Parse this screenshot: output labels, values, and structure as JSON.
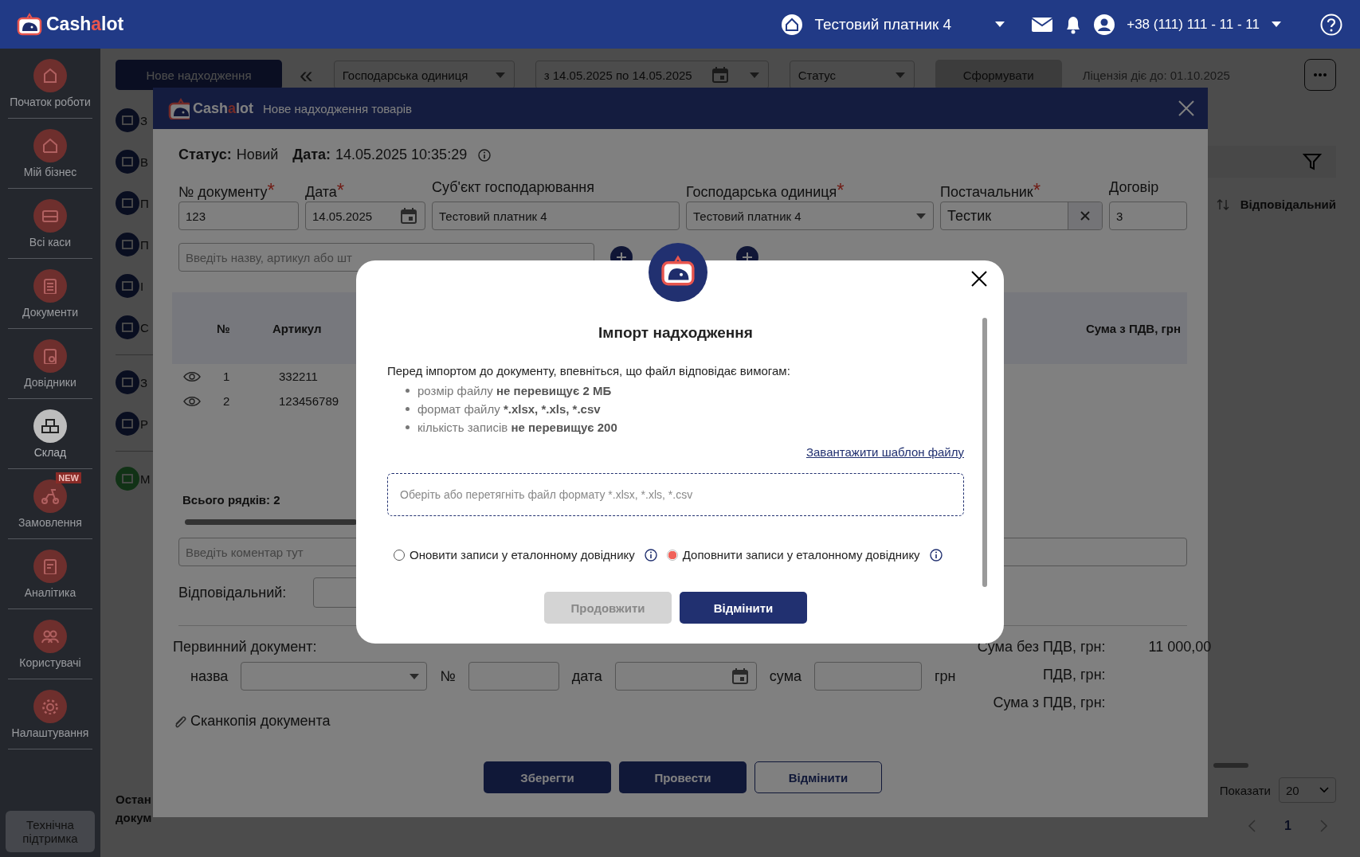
{
  "topbar": {
    "logo": [
      {
        "text": "Cash",
        "accent": false
      },
      {
        "text": "a",
        "accent": true
      },
      {
        "text": "lot",
        "accent": false
      }
    ],
    "company": "Тестовий платник 4",
    "phone": "+38 (111) 111 - 11 - 11"
  },
  "sidebar": {
    "items": [
      {
        "label": "Початок роботи",
        "selected": false
      },
      {
        "label": "Мій бізнес",
        "selected": false
      },
      {
        "label": "Всі каси",
        "selected": false
      },
      {
        "label": "Документи",
        "selected": false
      },
      {
        "label": "Довідники",
        "selected": false
      },
      {
        "label": "Склад",
        "selected": true
      },
      {
        "label": "Замовлення",
        "selected": false,
        "badge": "NEW"
      },
      {
        "label": "Аналітика",
        "selected": false
      },
      {
        "label": "Користувачі",
        "selected": false
      },
      {
        "label": "Налаштування",
        "selected": false
      }
    ],
    "support": "Технічна підтримка"
  },
  "toolbar": {
    "new_button": "Нове надходження",
    "collapse": "«",
    "filters": [
      "Господарська одиниця",
      "з 14.05.2025 по 14.05.2025",
      "Статус"
    ],
    "generate_button": "Сформувати",
    "license": "Ліцензія діє до: 01.10.2025"
  },
  "submenu": {
    "items": [
      "З",
      "В",
      "П",
      "П",
      "І",
      "С",
      "З",
      "Р",
      "М"
    ]
  },
  "list": {
    "column": "Відповідальний",
    "footer": [
      "Остан",
      "докум"
    ],
    "show_label": "Показати",
    "page_size": "20",
    "page": "1"
  },
  "document": {
    "logo": [
      {
        "text": "Cash",
        "accent": false
      },
      {
        "text": "a",
        "accent": true
      },
      {
        "text": "lot",
        "accent": false
      }
    ],
    "title": "Нове надходження товарів",
    "status_label": "Статус:",
    "status": "Новий",
    "date_label": "Дата:",
    "date": "14.05.2025 10:35:29",
    "fields": [
      {
        "label": "№ документу",
        "required_mark": "*",
        "value": "123",
        "kind": "text"
      },
      {
        "label": "Дата",
        "required_mark": "*",
        "value": "14.05.2025",
        "kind": "date"
      },
      {
        "label": "Суб'єкт господарювання",
        "value": "Тестовий платник 4",
        "kind": "text"
      },
      {
        "label": "Господарська одиниця",
        "required_mark": "*",
        "value": "Тестовий платник 4",
        "kind": "select"
      },
      {
        "label": "Постачальник",
        "required_mark": "*",
        "value": "Тестик",
        "kind": "clearable"
      },
      {
        "label": "Договір",
        "value": "3",
        "kind": "text"
      }
    ],
    "search_placeholder": "Введіть назву, артикул або шт",
    "columns": [
      "№",
      "Артикул",
      "Сума з ПДВ, грн"
    ],
    "rows": [
      {
        "number": "1",
        "article": "332211"
      },
      {
        "number": "2",
        "article": "123456789"
      }
    ],
    "total_rows": "Всього рядків: 2",
    "comment_placeholder": "Введіть коментар тут",
    "responsible_label": "Відповідальний:",
    "primary": {
      "title": "Первинний документ:",
      "name_label": "назва",
      "number_label": "№",
      "date_label": "дата",
      "sum_label": "сума",
      "currency": "грн"
    },
    "totals": [
      {
        "label": "Сума без ПДВ, грн:",
        "value": "11 000,00"
      },
      {
        "label": "ПДВ, грн:"
      },
      {
        "label": "Сума з ПДВ, грн:"
      }
    ],
    "attachment": "Сканкопія документа",
    "buttons": [
      {
        "label": "Зберегти",
        "kind": "primary"
      },
      {
        "label": "Провести",
        "kind": "primary"
      },
      {
        "label": "Відмінити",
        "kind": "outline"
      }
    ]
  },
  "import_dialog": {
    "title": "Імпорт надходження",
    "intro": "Перед імпортом до документу, впевніться, що файл відповідає вимогам:",
    "requirements": [
      "розмір файлу **не перевищує 2 МБ**",
      "формат файлу ***.xlsx, *.xls, *.csv**",
      "кількість записів **не перевищує 200**"
    ],
    "template_link": "Завантажити шаблон файлу",
    "dropzone_placeholder": "Оберіть або перетягніть файл формату *.xlsx, *.xls, *.csv",
    "options": [
      {
        "label": "Оновити записи у еталонному довіднику",
        "selected": false
      },
      {
        "label": "Доповнити записи у еталонному довіднику",
        "selected": true
      }
    ],
    "buttons": [
      {
        "label": "Продовжити",
        "kind": "primary",
        "disabled": true
      },
      {
        "label": "Відмінити",
        "kind": "primary",
        "disabled": false
      }
    ]
  }
}
